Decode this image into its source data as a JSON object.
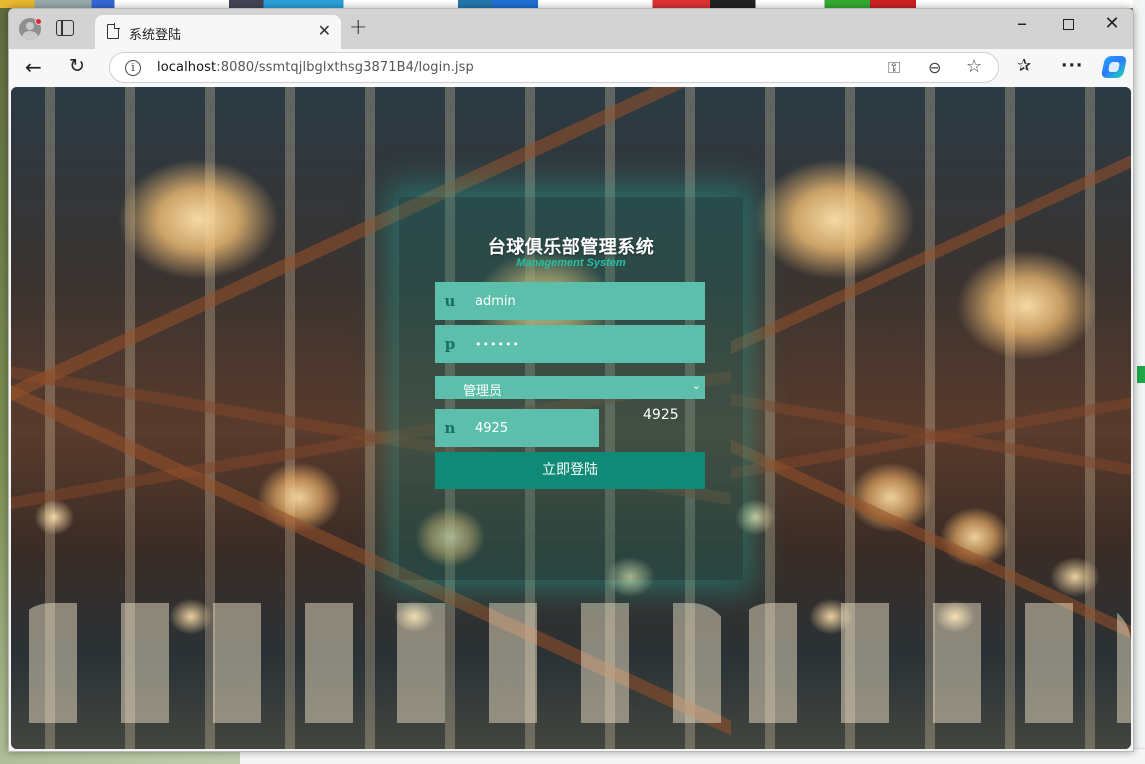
{
  "browser": {
    "tab_title": "系统登陆",
    "url_host": "localhost",
    "url_path": ":8080/ssmtqjlbglxthsg3871B4/login.jsp"
  },
  "login": {
    "title": "台球俱乐部管理系统",
    "subtitle": "Management System",
    "username_prefix": "u",
    "username_value": "admin",
    "password_prefix": "p",
    "password_value": "••••••",
    "role_value": "管理员",
    "code_prefix": "n",
    "code_input_value": "4925",
    "code_display": "4925",
    "submit_label": "立即登陆"
  },
  "colors": {
    "field_bg": "#5bbfab",
    "button_bg": "#0f8a76",
    "subtitle": "#24c2a2",
    "panel_glow": "#1eaaa0"
  },
  "icons": {
    "info": "info-icon",
    "key": "key-icon",
    "zoom": "zoom-out-icon",
    "favorite": "star-icon",
    "favorites_bar": "favorites-icon",
    "more": "more-icon",
    "copilot": "copilot-icon"
  }
}
